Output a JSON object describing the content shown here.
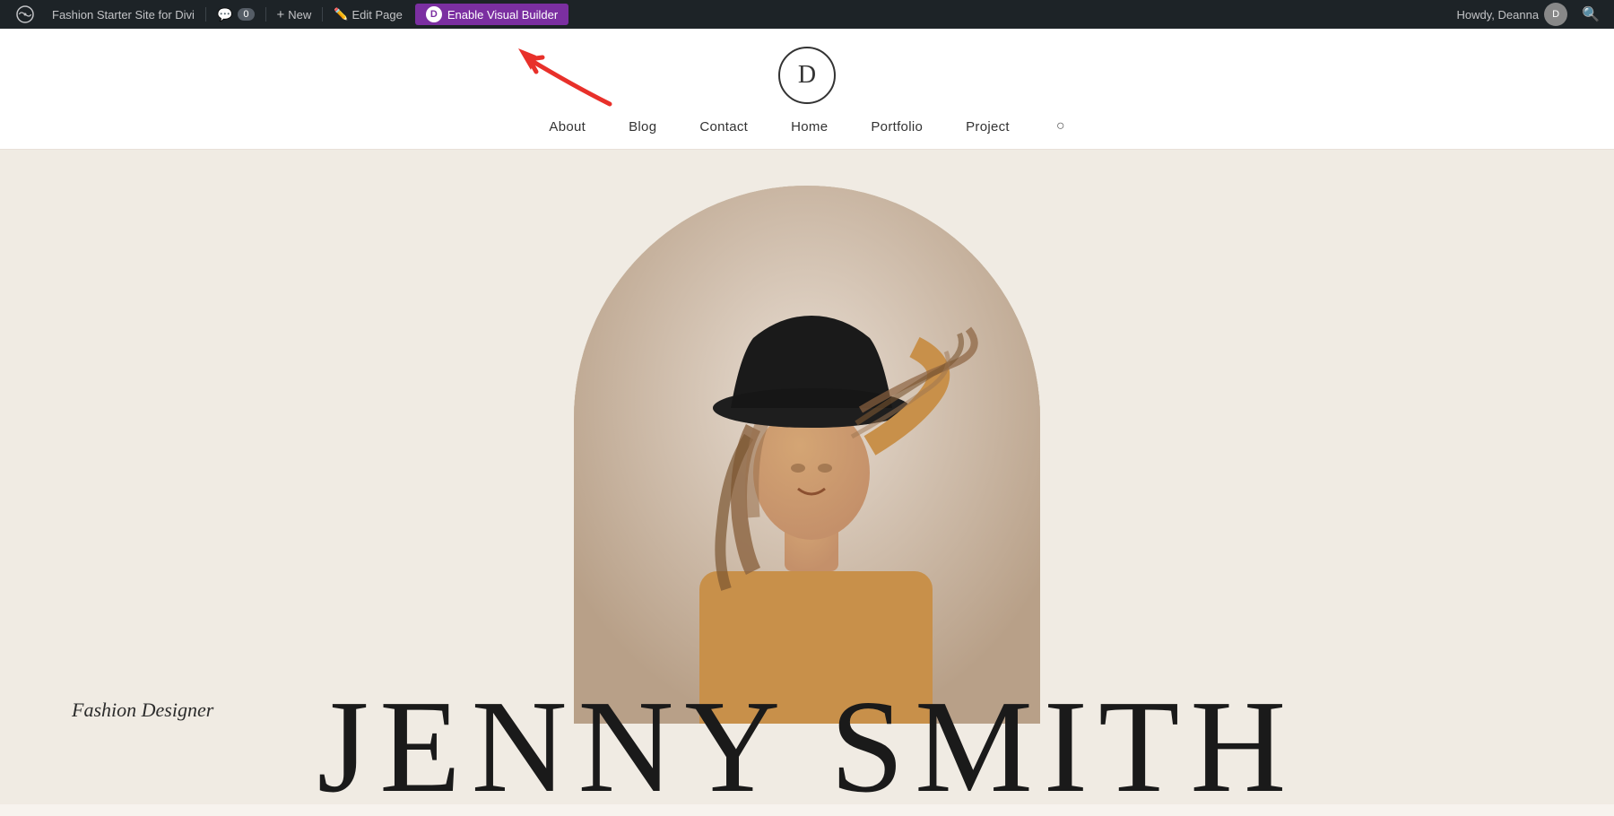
{
  "admin_bar": {
    "site_name": "Fashion Starter Site for Divi",
    "new_label": "New",
    "edit_page_label": "Edit Page",
    "enable_visual_builder_label": "Enable Visual Builder",
    "divi_icon": "D",
    "comment_count": "0",
    "howdy_text": "Howdy, Deanna",
    "wp_icon": "W"
  },
  "nav": {
    "logo_letter": "D",
    "links": [
      {
        "label": "About"
      },
      {
        "label": "Blog"
      },
      {
        "label": "Contact"
      },
      {
        "label": "Home"
      },
      {
        "label": "Portfolio"
      },
      {
        "label": "Project"
      }
    ]
  },
  "hero": {
    "subtitle": "Fashion Designer",
    "name": "JENNY SMITH",
    "image_alt": "Woman with hat"
  },
  "colors": {
    "admin_bar_bg": "#1d2327",
    "enable_vb_bg": "#7b2fa1",
    "hero_bg": "#f0ebe3",
    "arrow_color": "#e8302a"
  }
}
